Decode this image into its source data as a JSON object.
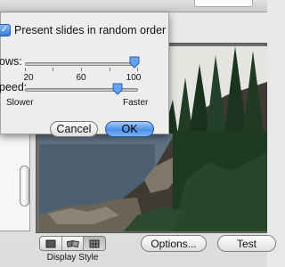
{
  "sheet": {
    "random_order_checkbox": {
      "label": "Present slides in random order",
      "checked": true
    },
    "shows_slider": {
      "label": "ows:",
      "ticks": [
        "20",
        "60",
        "100"
      ],
      "value": 100
    },
    "speed_slider": {
      "label": "peed:",
      "min_label": "Slower",
      "max_label": "Faster",
      "value_fraction": 0.82
    },
    "cancel_label": "Cancel",
    "ok_label": "OK"
  },
  "main": {
    "display_style_label": "Display Style",
    "display_style_options": [
      "single-slide-icon",
      "mosaic-icon",
      "grid-icon"
    ],
    "display_style_selected": 2,
    "options_label": "Options...",
    "test_label": "Test"
  },
  "colors": {
    "accent": "#4c8fe6",
    "sky": "#e9e9e6",
    "water": "#5a6d7c",
    "forest": "#1f3a22"
  }
}
